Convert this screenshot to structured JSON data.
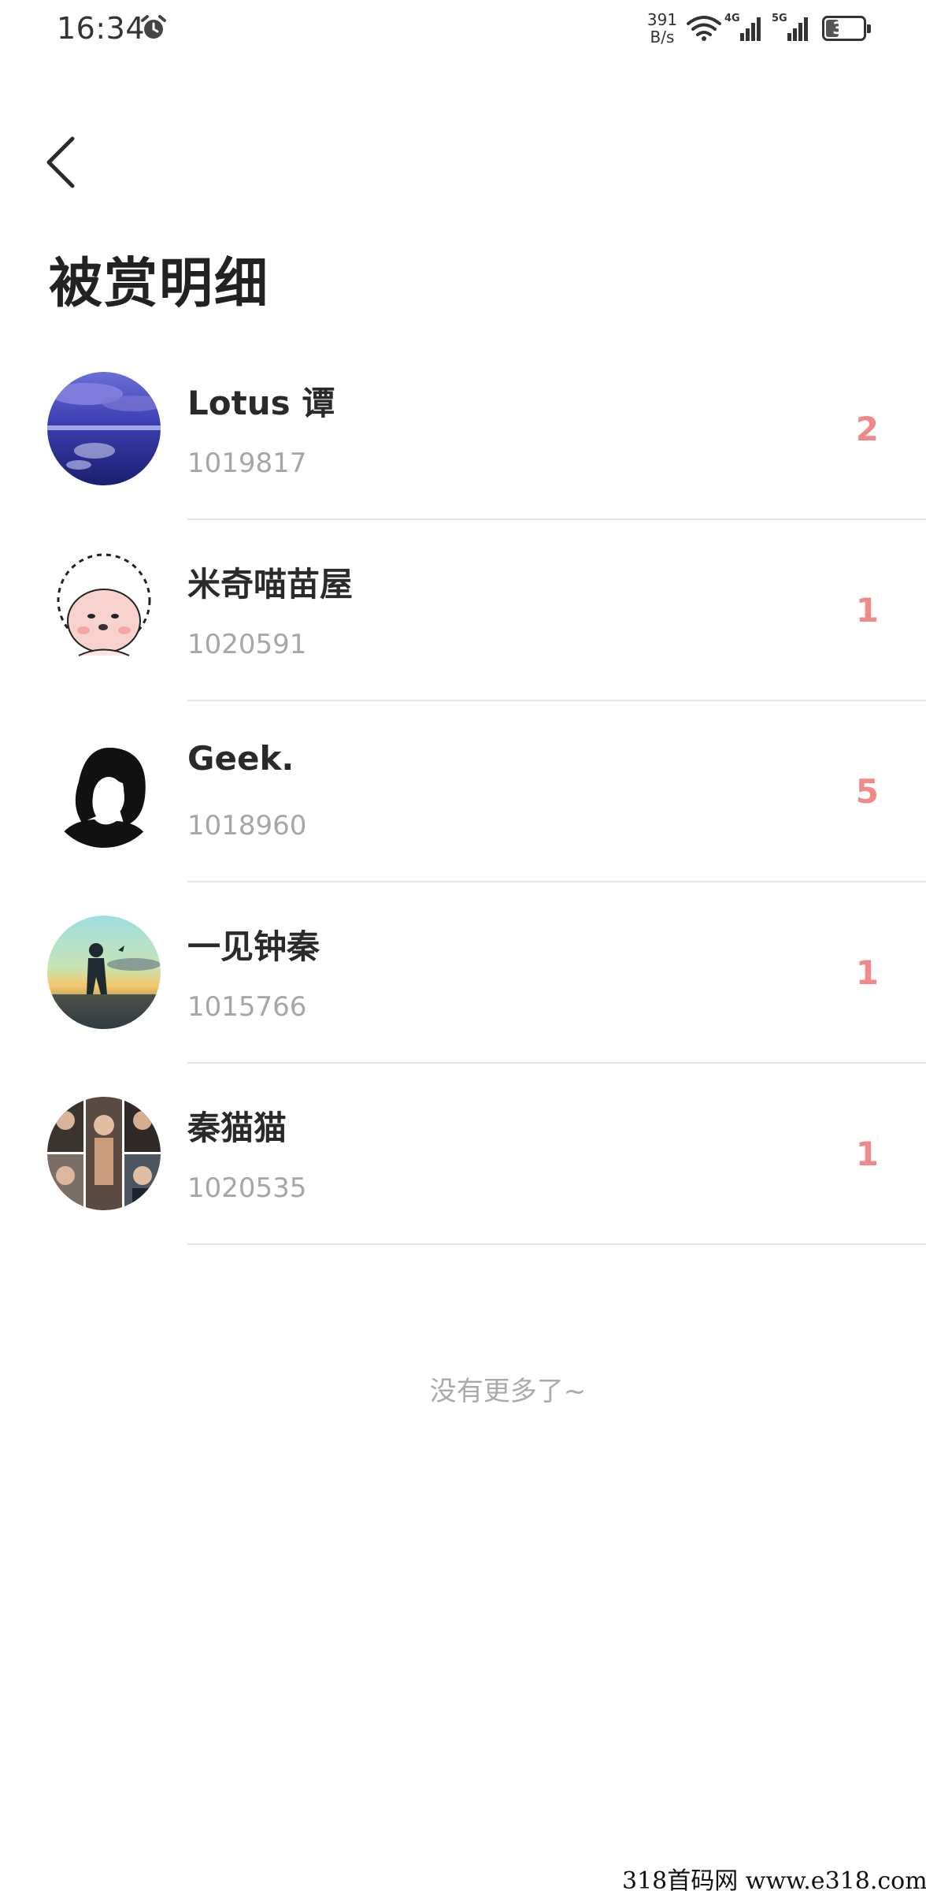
{
  "status_bar": {
    "time": "16:34",
    "net_speed_value": "391",
    "net_speed_unit": "B/s",
    "net1_label": "4G",
    "net2_label": "5G",
    "battery": "34",
    "battery_level": 0.34,
    "icons": [
      "alarm-icon",
      "wifi-icon",
      "signal-icon",
      "battery-icon"
    ]
  },
  "header": {
    "back_icon": "chevron-left-icon",
    "title": "被赏明细"
  },
  "accent_color": "#f08a8a",
  "list": {
    "items": [
      {
        "name": "Lotus 谭",
        "id": "1019817",
        "count": "2"
      },
      {
        "name": "米奇喵苗屋",
        "id": "1020591",
        "count": "1"
      },
      {
        "name": "Geek.",
        "id": "1018960",
        "count": "5"
      },
      {
        "name": "一见钟秦",
        "id": "1015766",
        "count": "1"
      },
      {
        "name": "秦猫猫",
        "id": "1020535",
        "count": "1"
      }
    ]
  },
  "footer": {
    "end_text": "没有更多了~"
  },
  "watermark": "318首码网  www.e318.com"
}
